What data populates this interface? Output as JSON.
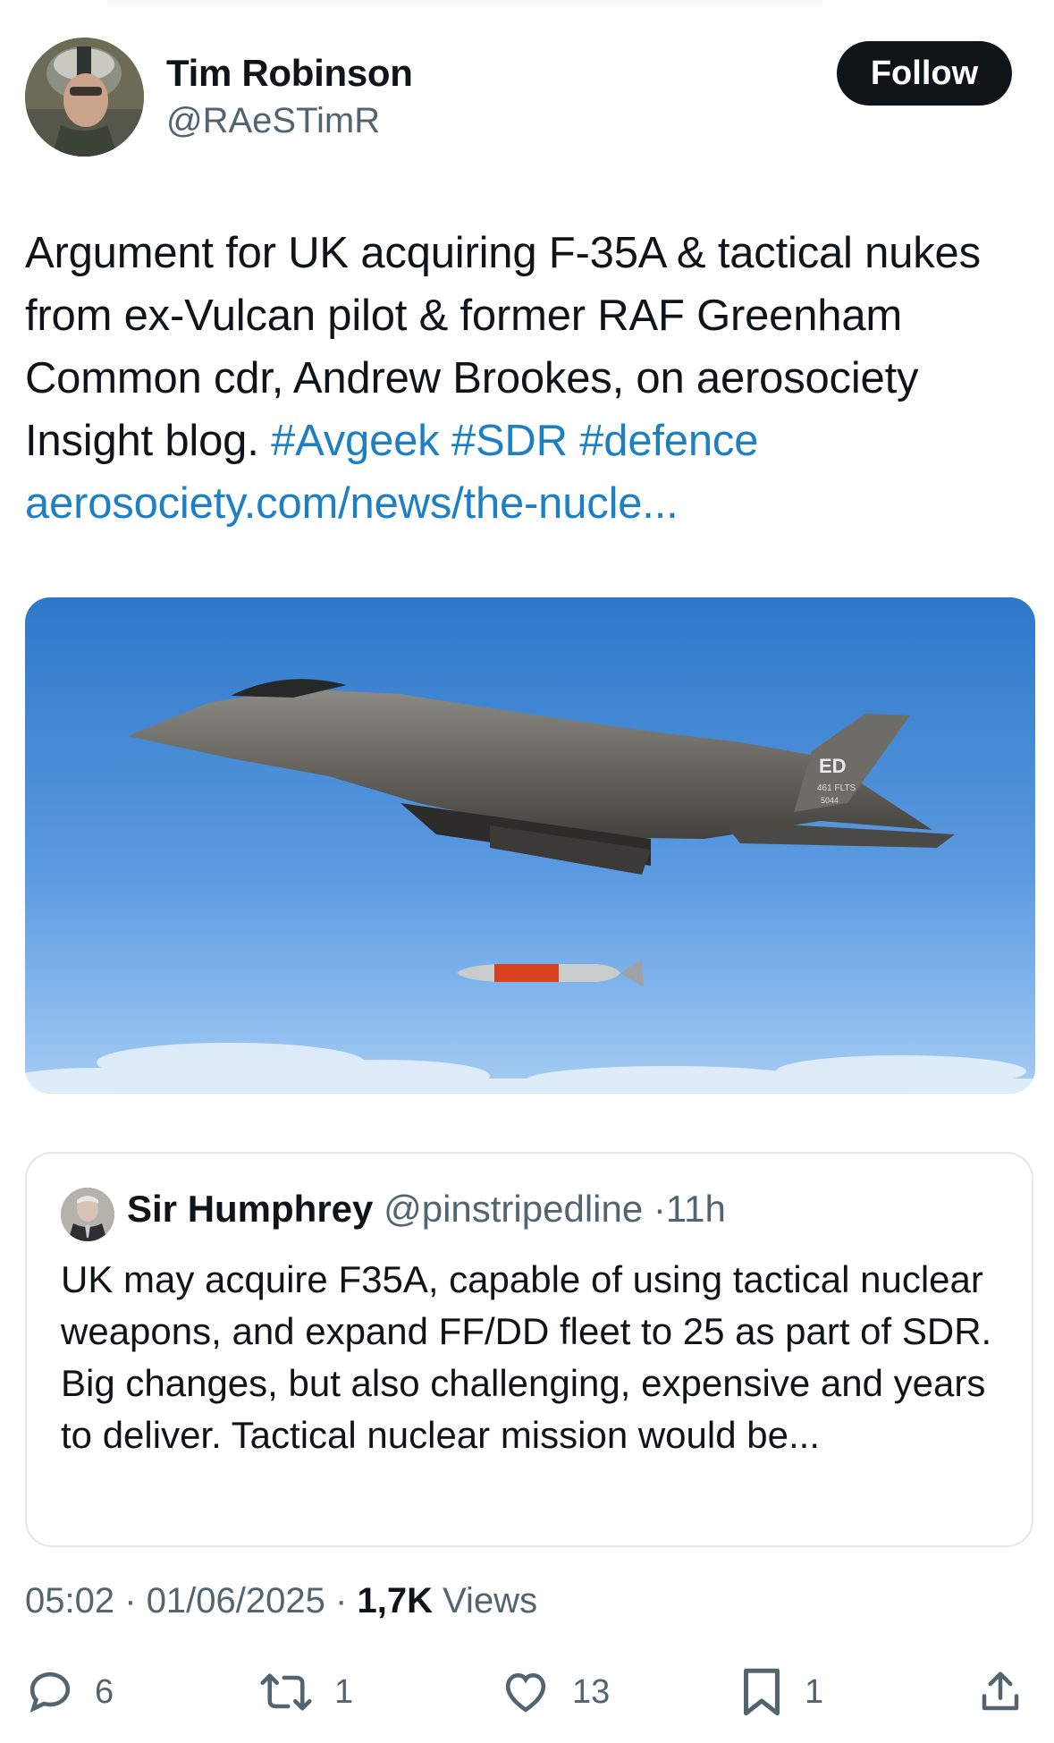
{
  "author": {
    "name": "Tim Robinson",
    "handle": "@RAeSTimR",
    "follow_label": "Follow"
  },
  "tweet": {
    "text_plain": "Argument for UK acquiring F-35A & tactical nukes from ex-Vulcan pilot & former RAF Greenham Common cdr, Andrew Brookes, on aerosociety Insight blog.",
    "hashtags": [
      "#Avgeek",
      "#SDR",
      "#defence"
    ],
    "link": "aerosociety.com/news/the-nucle..."
  },
  "media": {
    "aircraft_tail_code": "ED",
    "aircraft_tail_unit": "461 FLTS",
    "aircraft_serial": "5044"
  },
  "quote": {
    "name": "Sir Humphrey",
    "handle": "@pinstripedline",
    "separator": "·",
    "time": "11h",
    "line1": "UK may acquire F35A, capable of using tactical nuclear weapons, and expand FF/DD fleet to 25 as part of SDR.",
    "line2": "Big changes, but also challenging, expensive and years to deliver. Tactical nuclear mission would be..."
  },
  "meta": {
    "time": "05:02",
    "sep1": "·",
    "date": "01/06/2025",
    "sep2": "·",
    "views_count": "1,7K",
    "views_label": "Views"
  },
  "actions": {
    "replies": "6",
    "reposts": "1",
    "likes": "13",
    "bookmarks": "1",
    "icons": [
      "reply-icon",
      "repost-icon",
      "like-icon",
      "bookmark-icon",
      "share-icon"
    ]
  },
  "colors": {
    "link": "#1d80c3",
    "text": "#0f1419",
    "secondary": "#536471",
    "border": "#e4e8eb"
  }
}
